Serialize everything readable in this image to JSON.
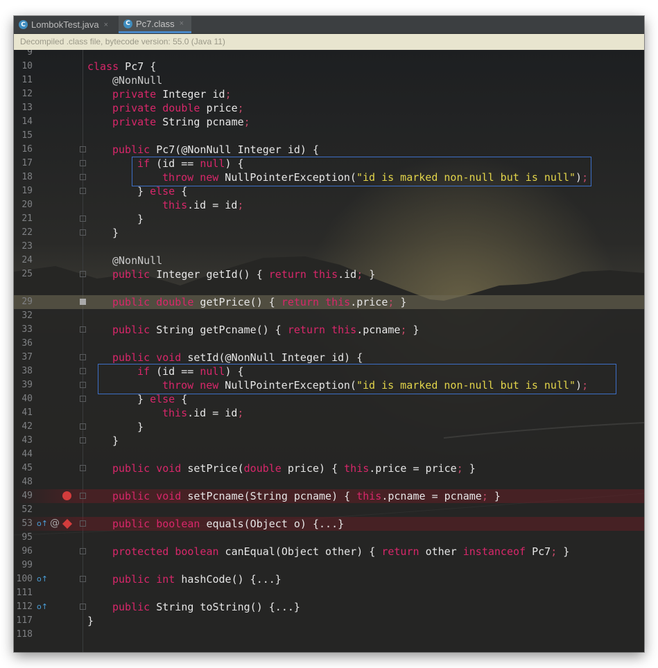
{
  "tabs": [
    {
      "label": "LombokTest.java",
      "icon": "class-c-icon",
      "close": "×"
    },
    {
      "label": "Pc7.class",
      "icon": "class-c-icon",
      "close": "×"
    }
  ],
  "notice": "Decompiled .class file, bytecode version: 55.0 (Java 11)",
  "colors": {
    "keyword": "#d8276a",
    "string": "#e2d44a",
    "text": "#e6e6e6",
    "highlight_border": "#3d6fc7",
    "breakpoint": "#d43c3c"
  },
  "lines": {
    "n9": "9",
    "n10": "10",
    "n11": "11",
    "n12": "12",
    "n13": "13",
    "n14": "14",
    "n15": "15",
    "n16": "16",
    "n17": "17",
    "n18": "18",
    "n19": "19",
    "n20": "20",
    "n21": "21",
    "n22": "22",
    "n23": "23",
    "n24": "24",
    "n25": "25",
    "n29": "29",
    "n32": "32",
    "n33": "33",
    "n36": "36",
    "n37": "37",
    "n38": "38",
    "n39": "39",
    "n40": "40",
    "n41": "41",
    "n42": "42",
    "n43": "43",
    "n44": "44",
    "n45": "45",
    "n48": "48",
    "n49": "49",
    "n52": "52",
    "n53": "53",
    "n95": "95",
    "n96": "96",
    "n99": "99",
    "n100": "100",
    "n111": "111",
    "n112": "112",
    "n117": "117",
    "n118": "118"
  },
  "code": {
    "class_kw": "class",
    "class_name": " Pc7 {",
    "nonnull": "@NonNull",
    "private": "private",
    "integer_id": " Integer id",
    "double": "double",
    "price": " price",
    "string_pcname": " String pcname",
    "public": "public",
    "ctor": " Pc7(@NonNull Integer id) {",
    "if": "if",
    "id_eq": " (id == ",
    "null": "null",
    "close_brace_paren": ") {",
    "throw": "throw",
    "new": "new",
    "npe": " NullPointerException(",
    "msg": "\"id is marked non-null but is null\"",
    "paren_close": ")",
    "semi": ";",
    "else_open": "} ",
    "else": "else",
    "brace_open": " {",
    "this": "this",
    "dot_id": ".id = id",
    "close": "}",
    "integer_getid": " Integer getId() { ",
    "return": "return",
    "dot_id_only": ".id",
    "getprice": " getPrice() { ",
    "dot_price": ".price",
    "string_getpcname": " String getPcname() { ",
    "dot_pcname": ".pcname",
    "void": "void",
    "setid": " setId(@NonNull Integer id) {",
    "setprice": " setPrice(",
    "price_param": " price) { ",
    "dot_price_eq": ".price = price",
    "setpcname": " setPcname(String pcname) { ",
    "dot_pcname_eq": ".pcname = pcname",
    "boolean": "boolean",
    "equals": " equals(Object o) {...}",
    "protected": "protected",
    "canequal": " canEqual(Object other) { ",
    "other": "other ",
    "instanceof": "instanceof",
    "pc7": " Pc7",
    "int": "int",
    "hashcode": " hashCode() {...}",
    "tostring": " String toString() {...}",
    "sp": " ",
    "end_brace": " }"
  },
  "gutter": {
    "at_sign": "@",
    "override_mark": "o↑"
  }
}
